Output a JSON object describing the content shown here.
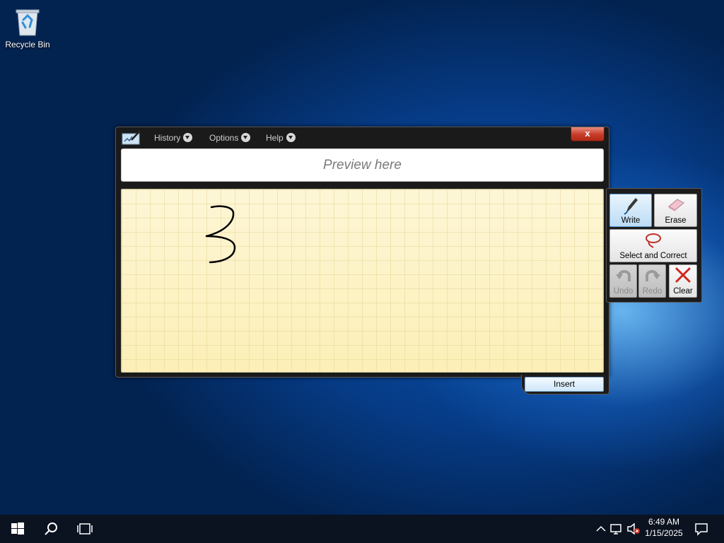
{
  "desktop": {
    "recycle_bin_label": "Recycle Bin"
  },
  "window": {
    "menu": {
      "history": "History",
      "options": "Options",
      "help": "Help"
    },
    "close_label": "x",
    "preview_text": "Preview here",
    "insert_label": "Insert"
  },
  "tools": {
    "write": "Write",
    "erase": "Erase",
    "select_correct": "Select and Correct",
    "undo": "Undo",
    "redo": "Redo",
    "clear": "Clear"
  },
  "taskbar": {
    "time": "6:49 AM",
    "date": "1/15/2025"
  },
  "colors": {
    "pad_background": "#fdf3c4",
    "active_tool": "#bcdcf5",
    "close_button": "#c63b28"
  },
  "icons": [
    "recycle-bin-icon",
    "input-panel-icon",
    "pen-icon",
    "eraser-icon",
    "lasso-icon",
    "undo-icon",
    "redo-icon",
    "clear-x-icon",
    "start-icon",
    "search-icon",
    "task-view-icon",
    "chevron-up-icon",
    "network-icon",
    "volume-muted-icon",
    "notification-icon"
  ]
}
